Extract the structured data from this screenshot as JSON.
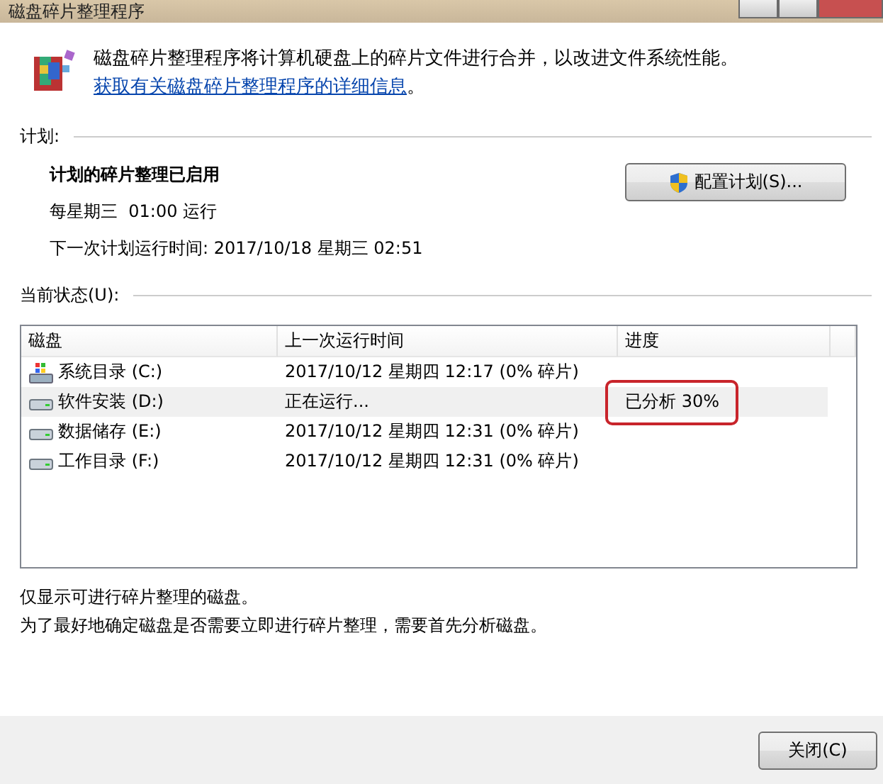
{
  "window": {
    "title": "磁盘碎片整理程序"
  },
  "intro": {
    "text": "磁盘碎片整理程序将计算机硬盘上的碎片文件进行合并，以改进文件系统性能。",
    "link": "获取有关磁盘碎片整理程序的详细信息",
    "tail": "。"
  },
  "schedule": {
    "heading": "计划:",
    "status": "计划的碎片整理已启用",
    "frequency": "每星期三  01:00 运行",
    "next_run": "下一次计划运行时间: 2017/10/18 星期三 02:51",
    "button": "配置计划(S)..."
  },
  "current_status": {
    "heading": "当前状态(U):",
    "columns": [
      "磁盘",
      "上一次运行时间",
      "进度"
    ],
    "rows": [
      {
        "kind": "system",
        "disk": "系统目录 (C:)",
        "last_run": "2017/10/12 星期四 12:17 (0% 碎片)",
        "selected": false
      },
      {
        "kind": "drive",
        "disk": "软件安装 (D:)",
        "last_run": "正在运行...",
        "progress": "已分析 30%",
        "selected": true,
        "highlighted": true
      },
      {
        "kind": "drive",
        "disk": "数据储存 (E:)",
        "last_run": "2017/10/12 星期四 12:31 (0% 碎片)",
        "selected": false
      },
      {
        "kind": "drive",
        "disk": "工作目录 (F:)",
        "last_run": "2017/10/12 星期四 12:31 (0% 碎片)",
        "selected": false
      }
    ]
  },
  "notes": [
    "仅显示可进行碎片整理的磁盘。",
    "为了最好地确定磁盘是否需要立即进行碎片整理，需要首先分析磁盘。"
  ],
  "close_button": "关闭(C)"
}
